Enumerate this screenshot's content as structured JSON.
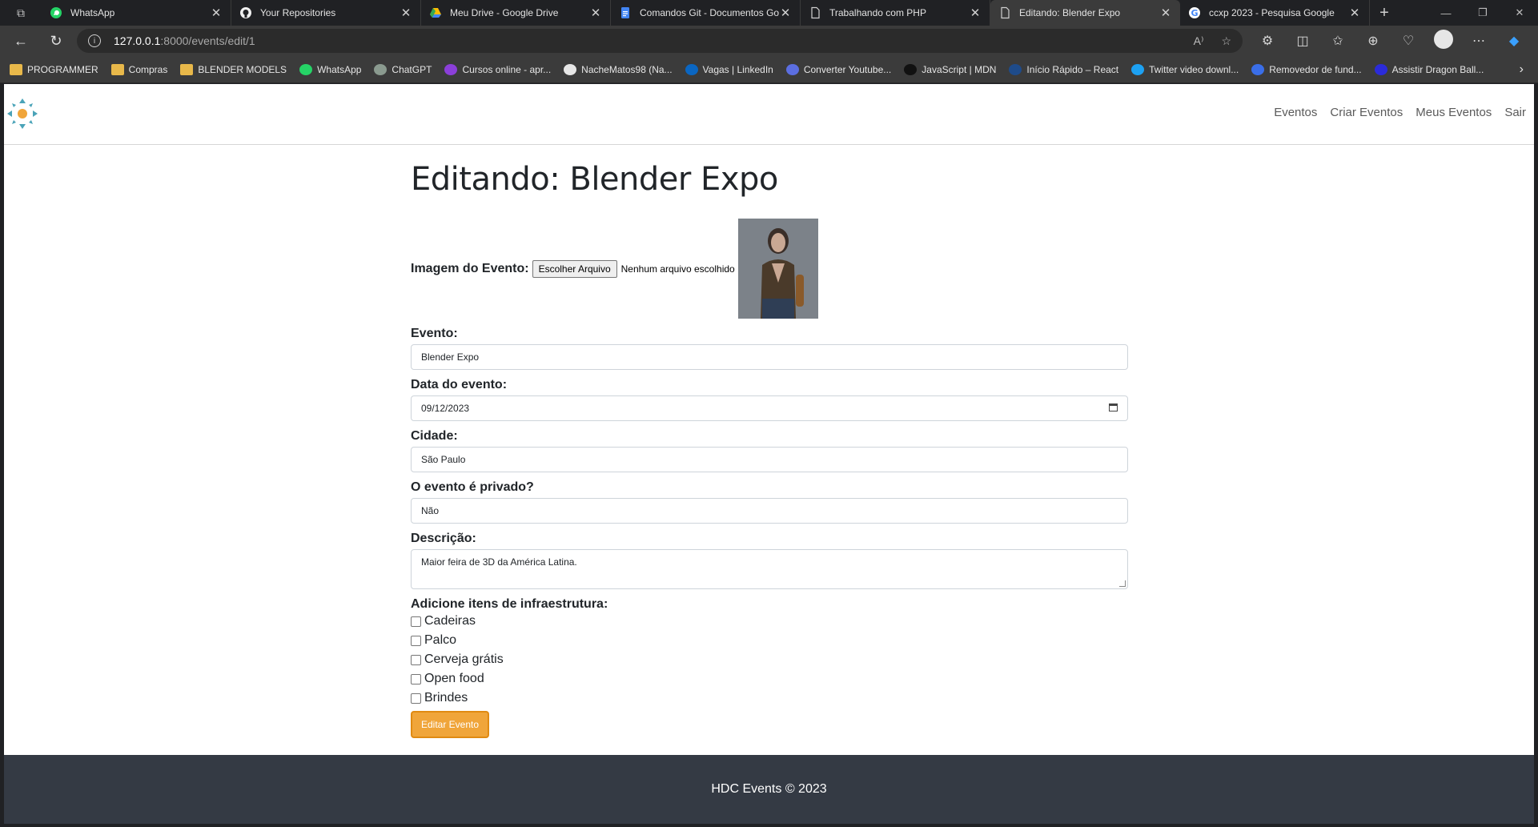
{
  "browser": {
    "tabs": [
      {
        "title": "WhatsApp",
        "icon": "whatsapp-icon"
      },
      {
        "title": "Your Repositories",
        "icon": "github-icon"
      },
      {
        "title": "Meu Drive - Google Drive",
        "icon": "google-drive-icon"
      },
      {
        "title": "Comandos Git - Documentos Go",
        "icon": "google-docs-icon"
      },
      {
        "title": "Trabalhando com PHP",
        "icon": "page-icon"
      },
      {
        "title": "Editando: Blender Expo",
        "icon": "page-icon"
      },
      {
        "title": "ccxp 2023 - Pesquisa Google",
        "icon": "google-icon"
      }
    ],
    "active_tab": 5,
    "address": {
      "host": "127.0.0.1",
      "path": ":8000/events/edit/1"
    },
    "bookmarks": [
      {
        "label": "PROGRAMMER",
        "color": "#e8b84a"
      },
      {
        "label": "Compras",
        "color": "#e8b84a"
      },
      {
        "label": "BLENDER MODELS",
        "color": "#e8b84a"
      },
      {
        "label": "WhatsApp",
        "color": "#25d366"
      },
      {
        "label": "ChatGPT",
        "color": "#8a9a8f"
      },
      {
        "label": "Cursos online - apr...",
        "color": "#8b3fd9"
      },
      {
        "label": "NacheMatos98 (Na...",
        "color": "#e6e6e6"
      },
      {
        "label": "Vagas | LinkedIn",
        "color": "#0a66c2"
      },
      {
        "label": "Converter Youtube...",
        "color": "#5b6ee1"
      },
      {
        "label": "JavaScript | MDN",
        "color": "#111111"
      },
      {
        "label": "Início Rápido – React",
        "color": "#1e4b8a"
      },
      {
        "label": "Twitter video downl...",
        "color": "#1da1f2"
      },
      {
        "label": "Removedor de fund...",
        "color": "#3a6ee8"
      },
      {
        "label": "Assistir Dragon Ball...",
        "color": "#2b2bd9"
      }
    ]
  },
  "site": {
    "nav": [
      "Eventos",
      "Criar Eventos",
      "Meus Eventos",
      "Sair"
    ],
    "footer": "HDC Events © 2023"
  },
  "form": {
    "title": "Editando: Blender Expo",
    "image_label": "Imagem do Evento:",
    "file_button": "Escolher Arquivo",
    "file_status": "Nenhum arquivo escolhido",
    "fields": {
      "event": {
        "label": "Evento:",
        "value": "Blender Expo"
      },
      "date": {
        "label": "Data do evento:",
        "value": "09/12/2023"
      },
      "city": {
        "label": "Cidade:",
        "value": "São Paulo"
      },
      "private": {
        "label": "O evento é privado?",
        "value": "Não"
      },
      "description": {
        "label": "Descrição:",
        "value": "Maior feira de 3D da América Latina."
      }
    },
    "infra_label": "Adicione itens de infraestrutura:",
    "infra_items": [
      "Cadeiras",
      "Palco",
      "Cerveja grátis",
      "Open food",
      "Brindes"
    ],
    "submit": "Editar Evento",
    "accent_color": "#f0a53a"
  }
}
